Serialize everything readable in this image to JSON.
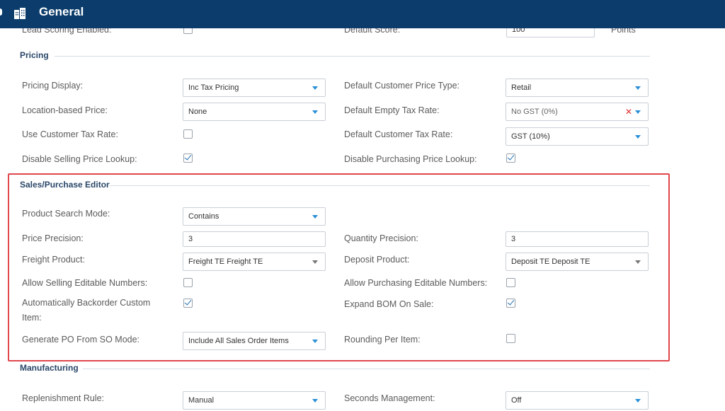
{
  "header": {
    "title": "General"
  },
  "top_row": {
    "lead_scoring_label": "Lead Scoring Enabled:",
    "default_score_label": "Default Score:",
    "default_score_value": "100",
    "points_label": "Points"
  },
  "pricing": {
    "title": "Pricing",
    "pricing_display_label": "Pricing Display:",
    "pricing_display_value": "Inc Tax Pricing",
    "default_customer_price_type_label": "Default Customer Price Type:",
    "default_customer_price_type_value": "Retail",
    "location_based_price_label": "Location-based Price:",
    "location_based_price_value": "None",
    "default_empty_tax_rate_label": "Default Empty Tax Rate:",
    "default_empty_tax_rate_value": "No GST (0%)",
    "use_customer_tax_rate_label": "Use Customer Tax Rate:",
    "default_customer_tax_rate_label": "Default Customer Tax Rate:",
    "default_customer_tax_rate_value": "GST (10%)",
    "disable_selling_price_lookup_label": "Disable Selling Price Lookup:",
    "disable_purchasing_price_lookup_label": "Disable Purchasing Price Lookup:"
  },
  "sales_purchase_editor": {
    "title": "Sales/Purchase Editor",
    "product_search_mode_label": "Product Search Mode:",
    "product_search_mode_value": "Contains",
    "price_precision_label": "Price Precision:",
    "price_precision_value": "3",
    "quantity_precision_label": "Quantity Precision:",
    "quantity_precision_value": "3",
    "freight_product_label": "Freight Product:",
    "freight_product_value": "Freight TE Freight TE",
    "deposit_product_label": "Deposit Product:",
    "deposit_product_value": "Deposit TE Deposit TE",
    "allow_selling_editable_numbers_label": "Allow Selling Editable Numbers:",
    "allow_purchasing_editable_numbers_label": "Allow Purchasing Editable Numbers:",
    "auto_backorder_custom_item_label": "Automatically Backorder Custom Item:",
    "expand_bom_on_sale_label": "Expand BOM On Sale:",
    "generate_po_from_so_mode_label": "Generate PO From SO Mode:",
    "generate_po_from_so_mode_value": "Include All Sales Order Items",
    "rounding_per_item_label": "Rounding Per Item:"
  },
  "manufacturing": {
    "title": "Manufacturing",
    "replenishment_rule_label": "Replenishment Rule:",
    "replenishment_rule_value": "Manual",
    "seconds_management_label": "Seconds Management:",
    "seconds_management_value": "Off"
  },
  "checkbox_states": {
    "lead_scoring_enabled": false,
    "use_customer_tax_rate": false,
    "disable_selling_price_lookup": true,
    "disable_purchasing_price_lookup": true,
    "allow_selling_editable_numbers": false,
    "allow_purchasing_editable_numbers": false,
    "auto_backorder_custom_item": true,
    "expand_bom_on_sale": true,
    "rounding_per_item": false
  },
  "colors": {
    "header_bg": "#0b3c6b",
    "section_title": "#2a4769",
    "dropdown_caret": "#2a8fd6",
    "highlight_border": "#e0474c",
    "clear_x": "#e03030"
  },
  "icons": {
    "header_icon": "building-icon",
    "dropdown": "caret-down-icon",
    "clear": "clear-x-icon"
  }
}
